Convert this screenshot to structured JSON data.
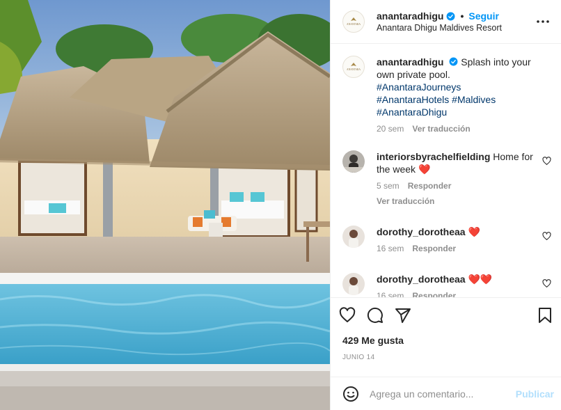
{
  "post": {
    "author": "anantaradhigu",
    "follow_label": "Seguir",
    "location": "Anantara Dhigu Maldives Resort",
    "logo_text": "ANANTARA"
  },
  "caption": {
    "username": "anantaradhigu",
    "text": "Splash into your own private pool.",
    "hashtags": [
      "#AnantaraJourneys",
      "#AnantaraHotels #Maldives",
      "#AnantaraDhigu"
    ],
    "time": "20 sem",
    "translate": "Ver traducción"
  },
  "comments": [
    {
      "username": "interiorsbyrachelfielding",
      "text": "Home for the week",
      "emoji": "❤️",
      "time": "5 sem",
      "reply": "Responder",
      "translate": "Ver traducción"
    },
    {
      "username": "dorothy_dorotheaa",
      "text": "",
      "emoji": "❤️",
      "time": "16 sem",
      "reply": "Responder"
    },
    {
      "username": "dorothy_dorotheaa",
      "text": "",
      "emoji": "❤️❤️",
      "time": "16 sem",
      "reply": "Responder"
    }
  ],
  "stats": {
    "likes": "429 Me gusta",
    "date": "JUNIO 14"
  },
  "composer": {
    "placeholder": "Agrega un comentario...",
    "publish": "Publicar"
  },
  "icons": {
    "more": "more-options-icon",
    "verified": "verified-badge-icon",
    "like": "heart-icon",
    "comment": "comment-icon",
    "share": "share-icon",
    "save": "bookmark-icon",
    "emoji": "emoji-icon"
  },
  "colors": {
    "accent": "#0095f6",
    "hashtag": "#00376b",
    "muted": "#8e8e8e",
    "heart": "#ed4956"
  }
}
